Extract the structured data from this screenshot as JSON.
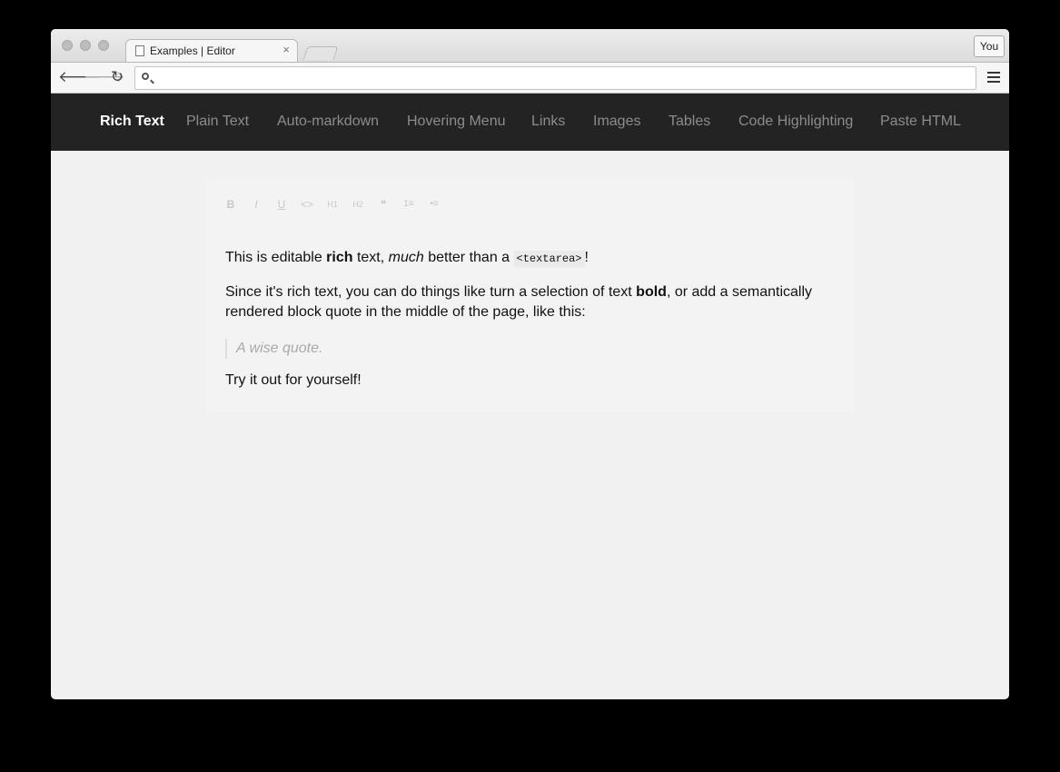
{
  "browser": {
    "tab_title": "Examples | Editor",
    "tab_close": "×",
    "profile_label": "You",
    "address_value": "",
    "icons": [
      "back-arrow-icon",
      "forward-arrow-icon",
      "reload-icon",
      "search-icon",
      "menu-icon"
    ]
  },
  "nav": {
    "items": [
      "Rich Text",
      "Plain Text",
      "Auto-markdown",
      "Hovering Menu",
      "Links",
      "Images",
      "Tables",
      "Code Highlighting",
      "Paste HTML"
    ],
    "active_index": 0
  },
  "editor": {
    "toolbar": [
      "B",
      "I",
      "U",
      "<>",
      "H1",
      "H2",
      "❝",
      "1≡",
      "•≡"
    ],
    "p1": {
      "a": "This is editable ",
      "b": "rich",
      "c": " text, ",
      "d": "much",
      "e": " better than a ",
      "code": "<textarea>",
      "f": "!"
    },
    "p2": {
      "a": "Since it's rich text, you can do things like turn a selection of text ",
      "b": "bold",
      "c": ", or add a semantically",
      "d": "rendered block quote in the middle of the page, like this:"
    },
    "quote": "A wise quote.",
    "p3": "Try it out for yourself!"
  }
}
